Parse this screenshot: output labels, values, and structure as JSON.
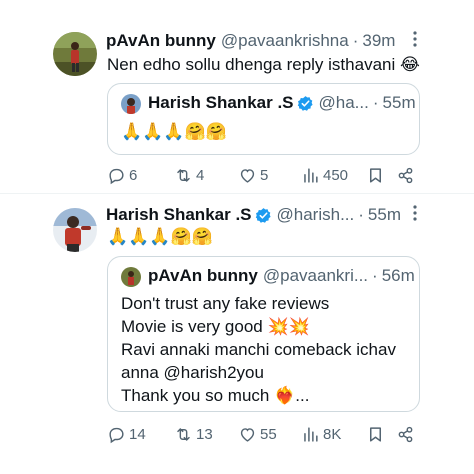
{
  "tweets": [
    {
      "author_name": "pAvAn bunny",
      "handle": "@pavaankrishna",
      "time": "39m",
      "text": "Nen edho sollu dhenga reply isthavani 😂",
      "quote": {
        "author_name": "Harish Shankar .S",
        "handle": "@ha...",
        "time": "55m",
        "text": "🙏🙏🙏🤗🤗"
      },
      "actions": {
        "replies": "6",
        "reposts": "4",
        "likes": "5",
        "views": "450"
      }
    },
    {
      "author_name": "Harish Shankar .S",
      "handle": "@harish...",
      "time": "55m",
      "text": "🙏🙏🙏🤗🤗",
      "quote": {
        "author_name": "pAvAn bunny",
        "handle": "@pavaankri...",
        "time": "56m",
        "lines": [
          "Don't trust any fake reviews",
          "Movie is very good 💥💥",
          "Ravi annaki manchi comeback ichav",
          "anna @harish2you",
          "Thank you so much ❤️‍🔥..."
        ]
      },
      "actions": {
        "replies": "14",
        "reposts": "13",
        "likes": "55",
        "views": "8K"
      }
    }
  ],
  "separator": "·",
  "icons": {
    "reply": "reply-icon",
    "repost": "repost-icon",
    "like": "like-icon",
    "views": "views-icon",
    "bookmark": "bookmark-icon",
    "share": "share-icon",
    "more": "more-icon",
    "verified": "verified-badge-icon"
  },
  "colors": {
    "text": "#0f1419",
    "secondary": "#536471",
    "border": "#cfd9de",
    "verified": "#1d9bf0"
  }
}
